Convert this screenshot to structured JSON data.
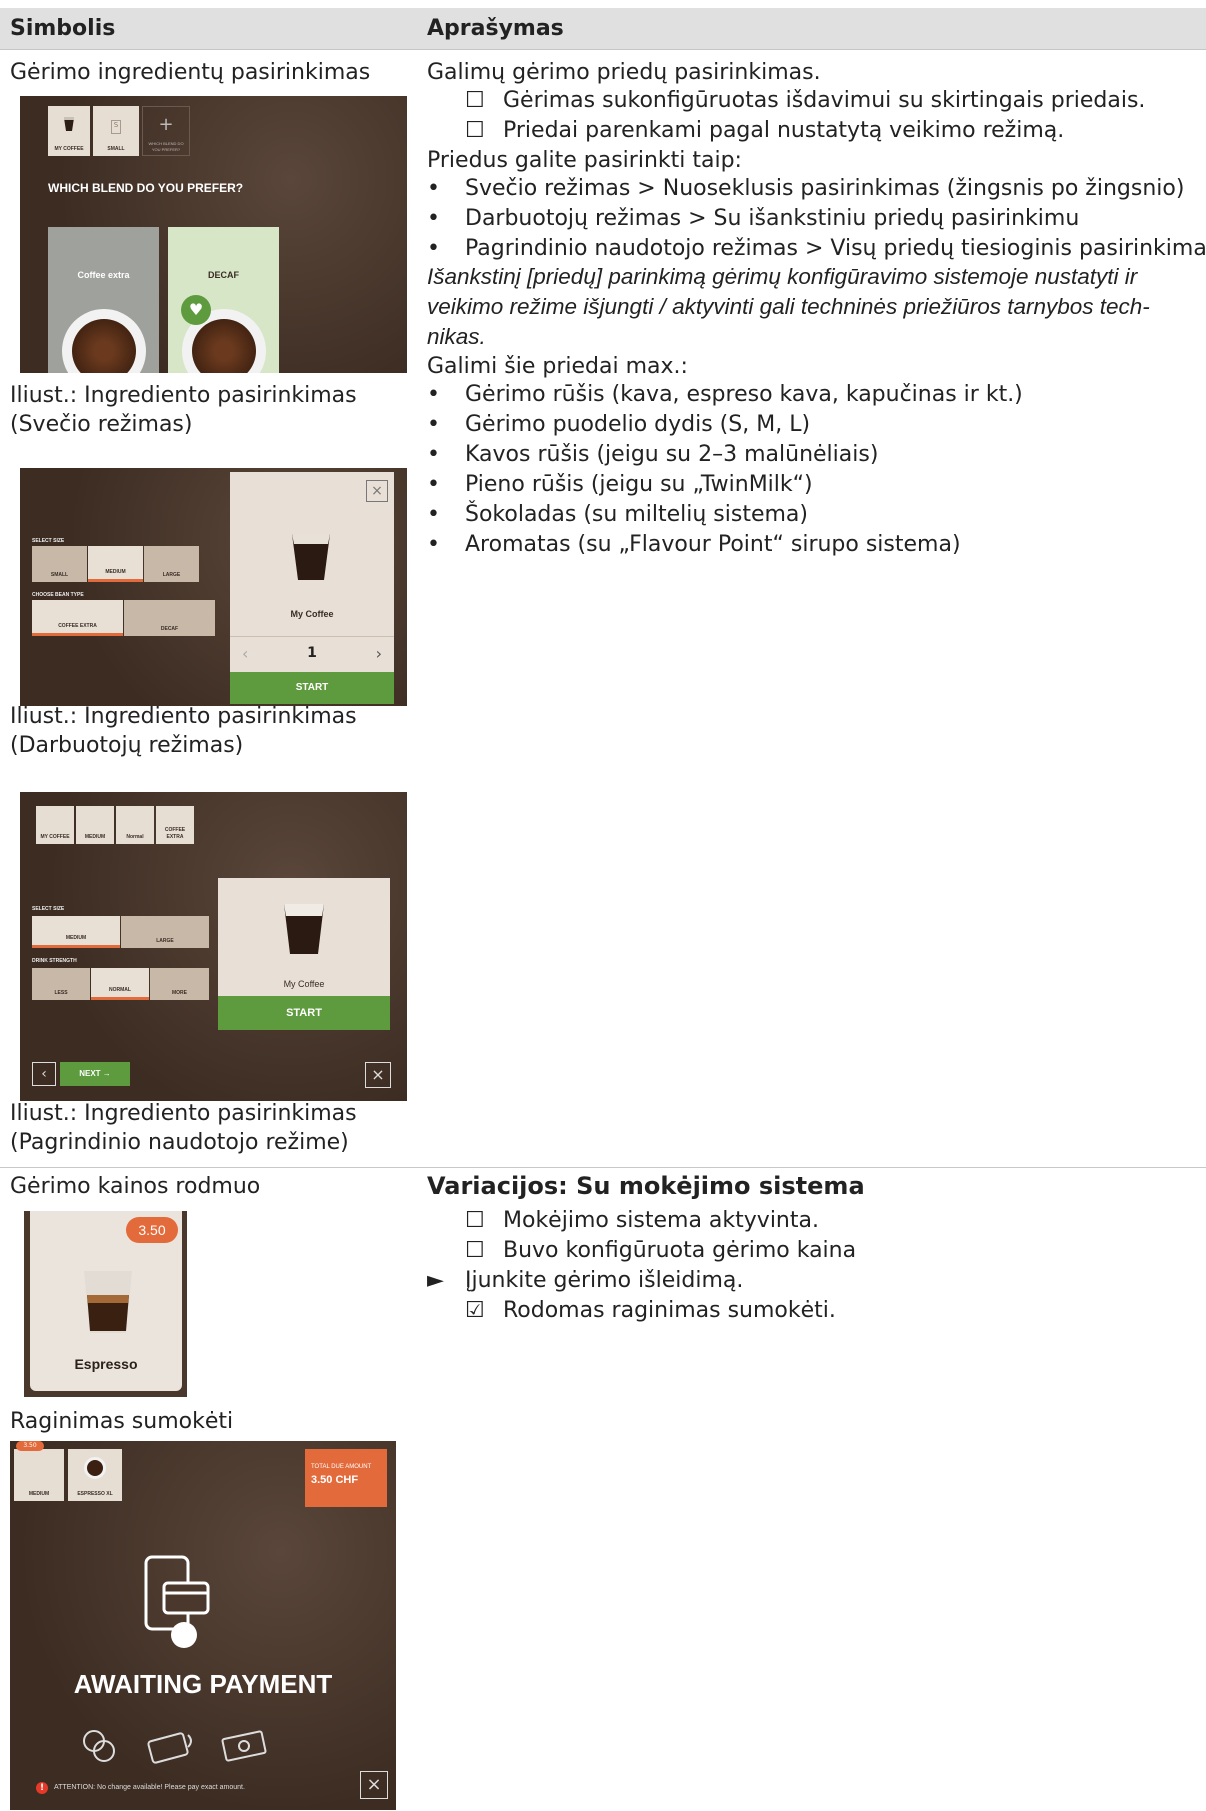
{
  "header": {
    "col1": "Simbolis",
    "col2": "Aprašymas"
  },
  "row1": {
    "symbol_title": "Gėrimo ingredientų pasirinkimas",
    "desc_intro": "Galimų gėrimo priedų pasirinkimas.",
    "preconditions": [
      {
        "marker": "☐",
        "text": "Gėrimas sukonfigūruotas išdavimui su skirtingais priedais."
      },
      {
        "marker": "☐",
        "text": "Priedai parenkami pagal nustatytą veikimo režimą."
      }
    ],
    "select_intro": "Priedus galite pasirinkti taip:",
    "modes": [
      {
        "marker": "•",
        "text": "Svečio režimas > Nuoseklusis pasirinkimas (žingsnis po žingsnio)"
      },
      {
        "marker": "•",
        "text": "Darbuotojų režimas > Su išankstiniu priedų pasirinkimu"
      },
      {
        "marker": "•",
        "text": "Pagrindinio naudotojo režimas > Visų priedų tiesioginis pasirinkimas"
      }
    ],
    "note_lines": [
      "Išankstinį [priedų] parinkimą gėrimų konfigūravimo sistemoje nustatyti ir",
      "veikimo režime išjungti / aktyvinti gali techninės priežiūros tarnybos tech-",
      "nikas."
    ],
    "options_intro": "Galimi šie priedai max.:",
    "options": [
      {
        "marker": "•",
        "text": "Gėrimo rūšis (kava, espreso kava, kapučinas ir kt.)"
      },
      {
        "marker": "•",
        "text": "Gėrimo puodelio dydis (S, M, L)"
      },
      {
        "marker": "•",
        "text": "Kavos rūšis (jeigu su 2–3 malūnėliais)"
      },
      {
        "marker": "•",
        "text": "Pieno rūšis (jeigu su „TwinMilk“)"
      },
      {
        "marker": "•",
        "text": "Šokoladas (su miltelių sistema)"
      },
      {
        "marker": "•",
        "text": "Aromatas (su „Flavour Point“ sirupo sistema)"
      }
    ],
    "captions": [
      {
        "line1": "Iliust.: Ingrediento pasirinkimas",
        "line2": "(Svečio režimas)"
      },
      {
        "line1": "Iliust.: Ingrediento pasirinkimas",
        "line2": "(Darbuotojų režimas)"
      },
      {
        "line1": "Iliust.: Ingrediento pasirinkimas",
        "line2": "(Pagrindinio naudotojo režime)"
      }
    ],
    "guest_screen": {
      "tiles": [
        "MY COFFEE",
        "SMALL",
        "WHICH BLEND DO YOU PREFER?"
      ],
      "question": "WHICH BLEND DO YOU PREFER?",
      "choice_left": "Coffee extra",
      "choice_right": "DECAF"
    },
    "staff_screen": {
      "size_caption": "SELECT SIZE",
      "sizes": [
        "SMALL",
        "MEDIUM",
        "LARGE"
      ],
      "bean_caption": "CHOOSE BEAN TYPE",
      "beans": [
        "COFFEE EXTRA",
        "DECAF"
      ],
      "product": "My Coffee",
      "quantity": "1",
      "start": "START"
    },
    "power_screen": {
      "tiles": [
        "MY COFFEE",
        "MEDIUM",
        "Normal",
        "COFFEE EXTRA"
      ],
      "size_caption": "SELECT SIZE",
      "sizes": [
        "MEDIUM",
        "LARGE"
      ],
      "strength_caption": "DRINK STRENGTH",
      "strengths": [
        "LESS",
        "NORMAL",
        "MORE"
      ],
      "product": "My Coffee",
      "start": "START",
      "next": "NEXT"
    }
  },
  "row2": {
    "symbol_title": "Gėrimo kainos rodmuo",
    "price_tile": {
      "price": "3.50",
      "product": "Espresso"
    },
    "pay_caption": "Raginimas sumokėti",
    "payment_screen": {
      "tiles": [
        "MEDIUM",
        "ESPRESSO XL"
      ],
      "badge": "3.50",
      "total_label": "TOTAL DUE AMOUNT",
      "total_value": "3.50 CHF",
      "status": "AWAITING PAYMENT",
      "attention": "ATTENTION: No change available! Please pay exact amount."
    },
    "variation_heading": "Variacijos: Su mokėjimo sistema",
    "steps": [
      {
        "marker": "☐",
        "text": "Mokėjimo sistema aktyvinta.",
        "indent": true
      },
      {
        "marker": "☐",
        "text": "Buvo konfigūruota gėrimo kaina",
        "indent": true
      },
      {
        "marker": "►",
        "text": "Įjunkite gėrimo išleidimą.",
        "indent": false
      },
      {
        "marker": "☑",
        "text": "Rodomas raginimas sumokėti.",
        "indent": true
      }
    ]
  },
  "colors": {
    "header_bg": "#e0e0e0",
    "accent_orange": "#e36a3a",
    "start_green": "#5e9a3e",
    "screen_brown": "#4a382d"
  }
}
